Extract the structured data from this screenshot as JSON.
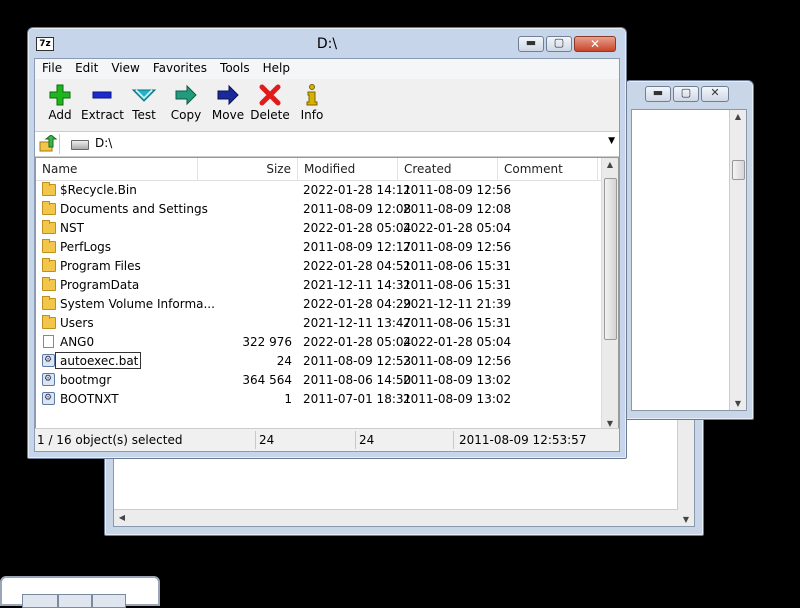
{
  "window": {
    "title": "D:\\",
    "app_icon": "7z"
  },
  "menu": [
    "File",
    "Edit",
    "View",
    "Favorites",
    "Tools",
    "Help"
  ],
  "toolbar": [
    {
      "label": "Add",
      "icon": "add-icon",
      "color": "#1fb51f"
    },
    {
      "label": "Extract",
      "icon": "extract-icon",
      "color": "#1a2bd1"
    },
    {
      "label": "Test",
      "icon": "test-icon",
      "color": "#21b4c9"
    },
    {
      "label": "Copy",
      "icon": "copy-icon",
      "color": "#229b7c"
    },
    {
      "label": "Move",
      "icon": "move-icon",
      "color": "#1b2a9a"
    },
    {
      "label": "Delete",
      "icon": "delete-icon",
      "color": "#e01b1b"
    },
    {
      "label": "Info",
      "icon": "info-icon",
      "color": "#d9b100"
    }
  ],
  "address": {
    "path": "D:\\"
  },
  "columns": {
    "name": "Name",
    "size": "Size",
    "modified": "Modified",
    "created": "Created",
    "comment": "Comment"
  },
  "files": [
    {
      "name": "$Recycle.Bin",
      "size": "",
      "modified": "2022-01-28 14:11",
      "created": "2011-08-09 12:56",
      "type": "folder"
    },
    {
      "name": "Documents and Settings",
      "size": "",
      "modified": "2011-08-09 12:08",
      "created": "2011-08-09 12:08",
      "type": "folder"
    },
    {
      "name": "NST",
      "size": "",
      "modified": "2022-01-28 05:04",
      "created": "2022-01-28 05:04",
      "type": "folder"
    },
    {
      "name": "PerfLogs",
      "size": "",
      "modified": "2011-08-09 12:17",
      "created": "2011-08-09 12:56",
      "type": "folder"
    },
    {
      "name": "Program Files",
      "size": "",
      "modified": "2022-01-28 04:51",
      "created": "2011-08-06 15:31",
      "type": "folder"
    },
    {
      "name": "ProgramData",
      "size": "",
      "modified": "2021-12-11 14:31",
      "created": "2011-08-06 15:31",
      "type": "folder"
    },
    {
      "name": "System Volume Informa...",
      "size": "",
      "modified": "2022-01-28 04:29",
      "created": "2021-12-11 21:39",
      "type": "folder"
    },
    {
      "name": "Users",
      "size": "",
      "modified": "2021-12-11 13:47",
      "created": "2011-08-06 15:31",
      "type": "folder"
    },
    {
      "name": "ANG0",
      "size": "322 976",
      "modified": "2022-01-28 05:04",
      "created": "2022-01-28 05:04",
      "type": "file"
    },
    {
      "name": "autoexec.bat",
      "size": "24",
      "modified": "2011-08-09 12:53",
      "created": "2011-08-09 12:56",
      "type": "system",
      "renaming": true
    },
    {
      "name": "bootmgr",
      "size": "364 564",
      "modified": "2011-08-06 14:50",
      "created": "2011-08-09 13:02",
      "type": "system"
    },
    {
      "name": "BOOTNXT",
      "size": "1",
      "modified": "2011-07-01 18:31",
      "created": "2011-08-09 13:02",
      "type": "system"
    }
  ],
  "status": {
    "selection": "1 / 16 object(s) selected",
    "size": "24",
    "packed": "24",
    "modified": "2011-08-09 12:53:57"
  }
}
